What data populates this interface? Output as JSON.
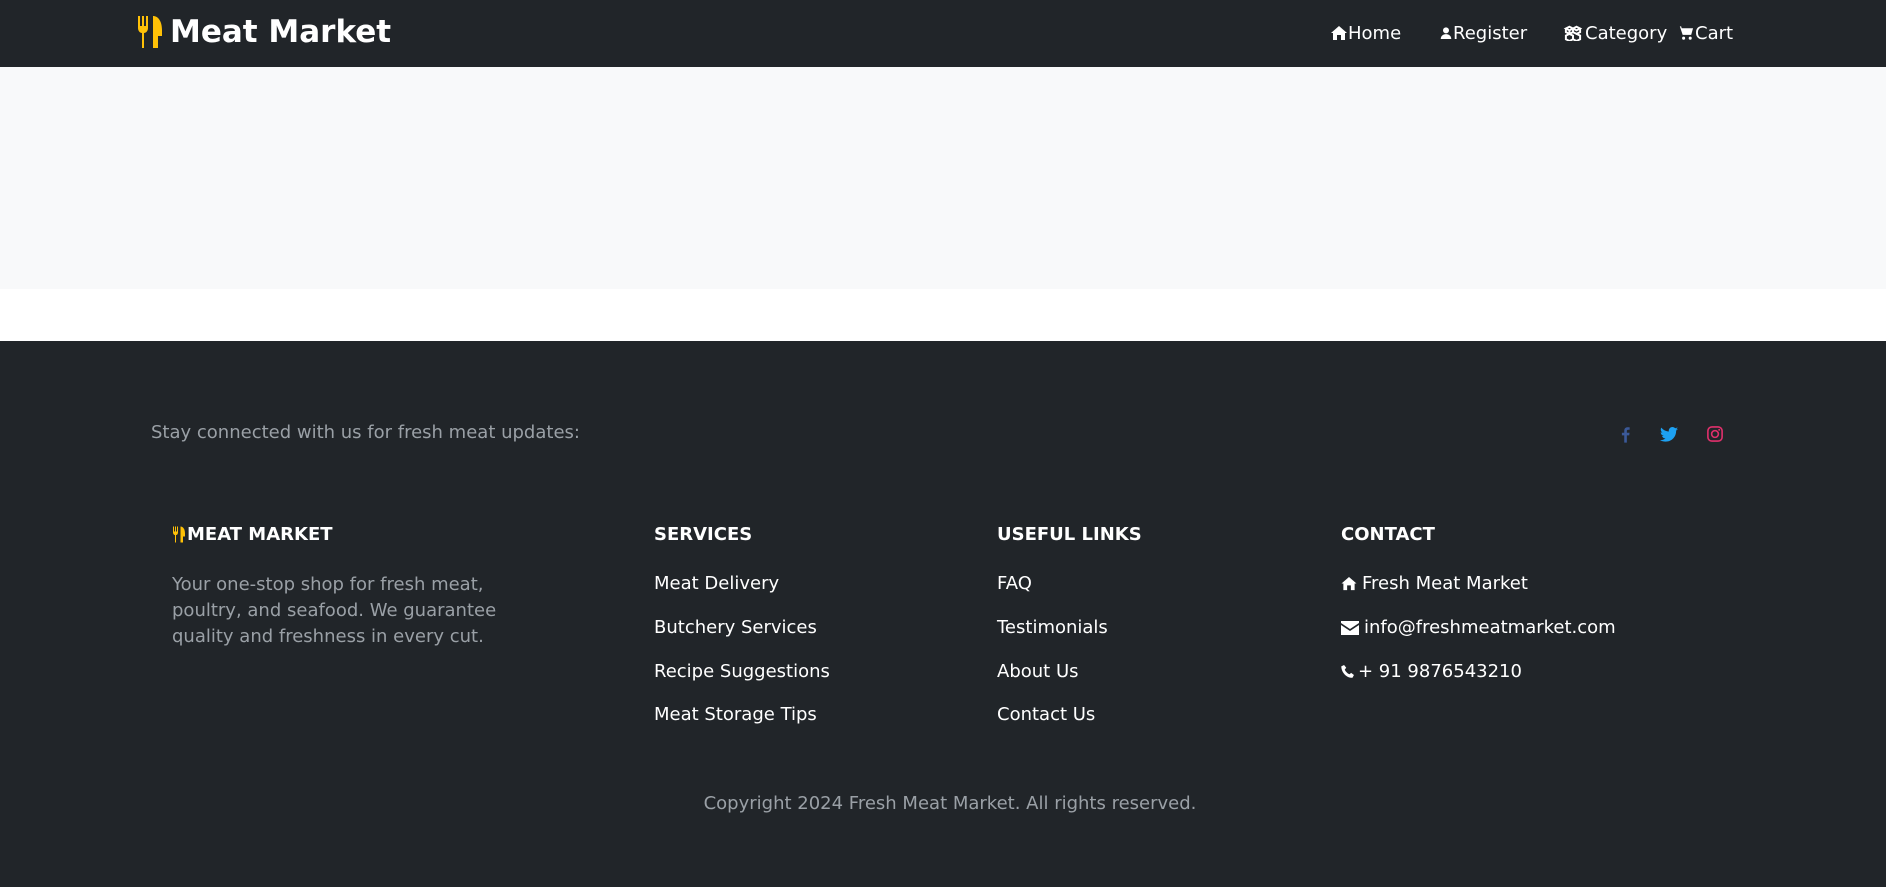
{
  "navbar": {
    "brand": "Meat Market",
    "brand_icon": "utensils-icon",
    "links": [
      {
        "label": "Home",
        "icon": "home-icon"
      },
      {
        "label": "Register",
        "icon": "user-icon"
      },
      {
        "label": "Category",
        "icon": "cubes-icon"
      },
      {
        "label": "Cart",
        "icon": "cart-icon"
      }
    ]
  },
  "footer": {
    "stay_connected": "Stay connected with us for fresh meat updates:",
    "social": [
      {
        "icon": "facebook-icon",
        "color": "#3b5998"
      },
      {
        "icon": "twitter-icon",
        "color": "#1da1f2"
      },
      {
        "icon": "instagram-icon",
        "color": "#e1306c"
      }
    ],
    "about": {
      "title": "MEAT MARKET",
      "text": "Your one-stop shop for fresh meat, poultry, and seafood. We guarantee quality and freshness in every cut."
    },
    "services": {
      "title": "SERVICES",
      "items": [
        "Meat Delivery",
        "Butchery Services",
        "Recipe Suggestions",
        "Meat Storage Tips"
      ]
    },
    "useful_links": {
      "title": "USEFUL LINKS",
      "items": [
        "FAQ",
        "Testimonials",
        "About Us",
        "Contact Us"
      ]
    },
    "contact": {
      "title": "CONTACT",
      "address": "Fresh Meat Market",
      "email": "info@freshmeatmarket.com",
      "phone": "+ 91 9876543210"
    },
    "copyright": "Copyright 2024 Fresh Meat Market. All rights reserved."
  },
  "colors": {
    "dark": "#212529",
    "light": "#f8f9fa",
    "accent": "#ffc107",
    "muted_text": "#9aa0a6"
  }
}
